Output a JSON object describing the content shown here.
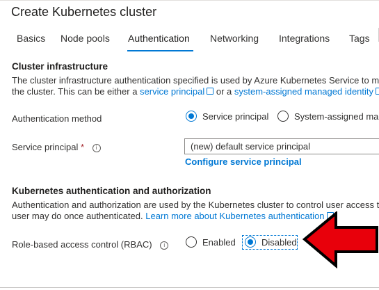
{
  "window": {
    "title": "Create Kubernetes cluster"
  },
  "tabs": [
    {
      "label": "Basics"
    },
    {
      "label": "Node pools"
    },
    {
      "label": "Authentication",
      "active": true
    },
    {
      "label": "Networking"
    },
    {
      "label": "Integrations"
    },
    {
      "label": "Tags"
    }
  ],
  "cluster_infra": {
    "heading": "Cluster infrastructure",
    "desc_line1": "The cluster infrastructure authentication specified is used by Azure Kubernetes Service to ma",
    "desc_line2_pre": "the cluster. This can be either a ",
    "link1": "service principal",
    "desc_mid": " or a ",
    "link2": "system-assigned managed identity"
  },
  "auth_method": {
    "label": "Authentication method",
    "options": [
      {
        "label": "Service principal",
        "selected": true
      },
      {
        "label": "System-assigned mar",
        "selected": false
      }
    ]
  },
  "service_principal": {
    "label": "Service principal",
    "required_mark": "*",
    "value": "(new) default service principal",
    "configure_link": "Configure service principal"
  },
  "k8s_auth": {
    "heading": "Kubernetes authentication and authorization",
    "desc_line1": "Authentication and authorization are used by the Kubernetes cluster to control user access to",
    "desc_line2_pre": "user may do once authenticated. ",
    "link": "Learn more about Kubernetes authentication"
  },
  "rbac": {
    "label": "Role-based access control (RBAC)",
    "options": [
      {
        "label": "Enabled",
        "selected": false
      },
      {
        "label": "Disabled",
        "selected": true
      }
    ]
  },
  "icons": {
    "info": "info-icon",
    "external": "external-link-icon",
    "annotation": "red-arrow-icon"
  },
  "colors": {
    "accent": "#0078d4",
    "arrow": "#e8000b",
    "required": "#a4262c"
  }
}
